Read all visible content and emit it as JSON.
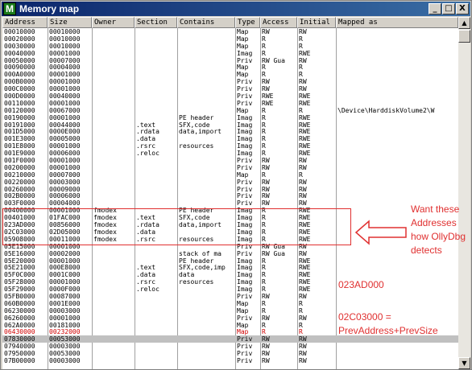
{
  "window": {
    "title": "Memory map",
    "icon_letter": "M",
    "minimize": "_",
    "maximize": "□",
    "close": "X"
  },
  "columns": [
    "Address",
    "Size",
    "Owner",
    "Section",
    "Contains",
    "Type",
    "Access",
    "Initial",
    "Mapped as"
  ],
  "rows": [
    [
      "00010000",
      "00010000",
      "",
      "",
      "",
      "Map",
      "RW",
      "RW",
      ""
    ],
    [
      "00020000",
      "00010000",
      "",
      "",
      "",
      "Map",
      "R",
      "R",
      ""
    ],
    [
      "00030000",
      "00010000",
      "",
      "",
      "",
      "Map",
      "R",
      "R",
      ""
    ],
    [
      "00040000",
      "00001000",
      "",
      "",
      "",
      "Imag",
      "R",
      "RWE",
      ""
    ],
    [
      "00050000",
      "00007000",
      "",
      "",
      "",
      "Priv",
      "RW  Gua",
      "RW",
      ""
    ],
    [
      "00090000",
      "00004000",
      "",
      "",
      "",
      "Map",
      "R",
      "R",
      ""
    ],
    [
      "000A0000",
      "00001000",
      "",
      "",
      "",
      "Map",
      "R",
      "R",
      ""
    ],
    [
      "000B0000",
      "00001000",
      "",
      "",
      "",
      "Priv",
      "RW",
      "RW",
      ""
    ],
    [
      "000C0000",
      "00001000",
      "",
      "",
      "",
      "Priv",
      "RW",
      "RW",
      ""
    ],
    [
      "000D0000",
      "00040000",
      "",
      "",
      "",
      "Priv",
      "RWE",
      "RWE",
      ""
    ],
    [
      "00110000",
      "00001000",
      "",
      "",
      "",
      "Priv",
      "RWE",
      "RWE",
      ""
    ],
    [
      "00120000",
      "00067000",
      "",
      "",
      "",
      "Map",
      "R",
      "R",
      "\\Device\\HarddiskVolume2\\W"
    ],
    [
      "00190000",
      "00001000",
      "",
      "",
      "PE header",
      "Imag",
      "R",
      "RWE",
      ""
    ],
    [
      "00191000",
      "00044000",
      "",
      ".text",
      "SFX,code",
      "Imag",
      "R",
      "RWE",
      ""
    ],
    [
      "001D5000",
      "0000E000",
      "",
      ".rdata",
      "data,import",
      "Imag",
      "R",
      "RWE",
      ""
    ],
    [
      "001E3000",
      "00005000",
      "",
      ".data",
      "",
      "Imag",
      "R",
      "RWE",
      ""
    ],
    [
      "001E8000",
      "00001000",
      "",
      ".rsrc",
      "resources",
      "Imag",
      "R",
      "RWE",
      ""
    ],
    [
      "001E9000",
      "00006000",
      "",
      ".reloc",
      "",
      "Imag",
      "R",
      "RWE",
      ""
    ],
    [
      "001F0000",
      "00001000",
      "",
      "",
      "",
      "Priv",
      "RW",
      "RW",
      ""
    ],
    [
      "00200000",
      "00001000",
      "",
      "",
      "",
      "Priv",
      "RW",
      "RW",
      ""
    ],
    [
      "00210000",
      "00007000",
      "",
      "",
      "",
      "Map",
      "R",
      "R",
      ""
    ],
    [
      "00220000",
      "00003000",
      "",
      "",
      "",
      "Priv",
      "RW",
      "RW",
      ""
    ],
    [
      "00260000",
      "00009000",
      "",
      "",
      "",
      "Priv",
      "RW",
      "RW",
      ""
    ],
    [
      "002B0000",
      "00006000",
      "",
      "",
      "",
      "Priv",
      "RW",
      "RW",
      ""
    ],
    [
      "003F0000",
      "00004000",
      "",
      "",
      "",
      "Priv",
      "RW",
      "RW",
      ""
    ],
    [
      "00400000",
      "00001000",
      "fmodex",
      "",
      "PE header",
      "Imag",
      "R",
      "RWE",
      ""
    ],
    [
      "00401000",
      "01FAC000",
      "fmodex",
      ".text",
      "SFX,code",
      "Imag",
      "R",
      "RWE",
      ""
    ],
    [
      "023AD000",
      "00856000",
      "fmodex",
      ".rdata",
      "data,import",
      "Imag",
      "R",
      "RWE",
      ""
    ],
    [
      "02C03000",
      "02D05000",
      "fmodex",
      ".data",
      "",
      "Imag",
      "R",
      "RWE",
      ""
    ],
    [
      "05908000",
      "00011000",
      "fmodex",
      ".rsrc",
      "resources",
      "Imag",
      "R",
      "RWE",
      ""
    ],
    [
      "05E15000",
      "00001000",
      "",
      "",
      "",
      "Priv",
      "RW  Gua",
      "RW",
      ""
    ],
    [
      "05E16000",
      "00002000",
      "",
      "",
      "stack of ma",
      "Priv",
      "RW  Gua",
      "RW",
      ""
    ],
    [
      "05E20000",
      "00001000",
      "",
      "",
      "PE header",
      "Imag",
      "R",
      "RWE",
      ""
    ],
    [
      "05E21000",
      "000E8000",
      "",
      ".text",
      "SFX,code,imp",
      "Imag",
      "R",
      "RWE",
      ""
    ],
    [
      "05F0C000",
      "0001C000",
      "",
      ".data",
      "data",
      "Imag",
      "R",
      "RWE",
      ""
    ],
    [
      "05F28000",
      "00001000",
      "",
      ".rsrc",
      "resources",
      "Imag",
      "R",
      "RWE",
      ""
    ],
    [
      "05F29000",
      "0000F000",
      "",
      ".reloc",
      "",
      "Imag",
      "R",
      "RWE",
      ""
    ],
    [
      "05FB0000",
      "00087000",
      "",
      "",
      "",
      "Priv",
      "RW",
      "RW",
      ""
    ],
    [
      "060B0000",
      "0001E000",
      "",
      "",
      "",
      "Map",
      "R",
      "R",
      ""
    ],
    [
      "06230000",
      "00003000",
      "",
      "",
      "",
      "Map",
      "R",
      "R",
      ""
    ],
    [
      "06260000",
      "00001000",
      "",
      "",
      "",
      "Priv",
      "RW",
      "RW",
      ""
    ],
    [
      "062A0000",
      "00181000",
      "",
      "",
      "",
      "Map",
      "R",
      "R",
      ""
    ],
    [
      "06430000",
      "00232000",
      "",
      "",
      "",
      "Map",
      "R",
      "R",
      ""
    ],
    [
      "07830000",
      "00053000",
      "",
      "",
      "",
      "Priv",
      "RW",
      "RW",
      ""
    ],
    [
      "07940000",
      "00003000",
      "",
      "",
      "",
      "Priv",
      "RW",
      "RW",
      ""
    ],
    [
      "07950000",
      "00053000",
      "",
      "",
      "",
      "Priv",
      "RW",
      "RW",
      ""
    ],
    [
      "07B00000",
      "00003000",
      "",
      "",
      "",
      "Priv",
      "RW",
      "RW",
      ""
    ]
  ],
  "annotations": {
    "box_note_lines": [
      "Want these",
      "Addresses",
      "how OllyDbg",
      "detects"
    ],
    "address_note": "023AD000",
    "formula_lines": [
      "02C03000 =",
      "PrevAddress+PrevSize"
    ]
  },
  "colors": {
    "title_bar": "#0a246a",
    "annotation": "#e03030",
    "red_row": "#d00000",
    "selected_row": "#c0c0c0"
  }
}
